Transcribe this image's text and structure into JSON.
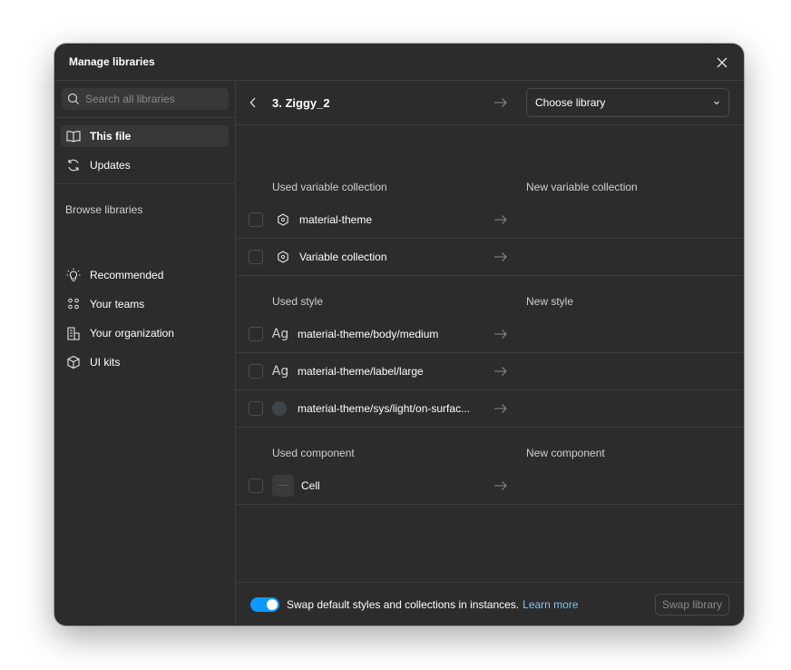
{
  "dialog": {
    "title": "Manage libraries",
    "close_icon": "close-icon"
  },
  "sidebar": {
    "search_placeholder": "Search all libraries",
    "items": [
      {
        "label": "This file",
        "icon": "book-icon",
        "active": true
      },
      {
        "label": "Updates",
        "icon": "refresh-icon",
        "active": false
      }
    ],
    "browse_title": "Browse libraries",
    "browse_items": [
      {
        "label": "Recommended",
        "icon": "lightbulb-icon"
      },
      {
        "label": "Your teams",
        "icon": "teams-icon"
      },
      {
        "label": "Your organization",
        "icon": "organization-icon"
      },
      {
        "label": "UI kits",
        "icon": "cube-icon"
      }
    ]
  },
  "main": {
    "file_name": "3. Ziggy_2",
    "choose_library": "Choose library",
    "variables": {
      "used_header": "Used variable collection",
      "new_header": "New variable collection",
      "rows": [
        {
          "label": "material-theme",
          "icon": "variable-collection-icon"
        },
        {
          "label": "Variable collection",
          "icon": "variable-collection-icon"
        }
      ]
    },
    "styles": {
      "used_header": "Used style",
      "new_header": "New style",
      "rows": [
        {
          "label": "material-theme/body/medium",
          "icon": "text-style-icon",
          "glyph": "Ag"
        },
        {
          "label": "material-theme/label/large",
          "icon": "text-style-icon",
          "glyph": "Ag"
        },
        {
          "label": "material-theme/sys/light/on-surfac...",
          "icon": "color-swatch-icon",
          "color": "#3f4448"
        }
      ]
    },
    "components": {
      "used_header": "Used component",
      "new_header": "New component",
      "rows": [
        {
          "label": "Cell",
          "icon": "component-thumbnail"
        }
      ]
    }
  },
  "footer": {
    "toggle_on": true,
    "text": "Swap default styles and collections in instances.",
    "link": "Learn more",
    "swap_button": "Swap library"
  },
  "colors": {
    "dialog_bg": "#2c2c2c",
    "accent": "#0d99ff",
    "link": "#7cc4fa"
  }
}
